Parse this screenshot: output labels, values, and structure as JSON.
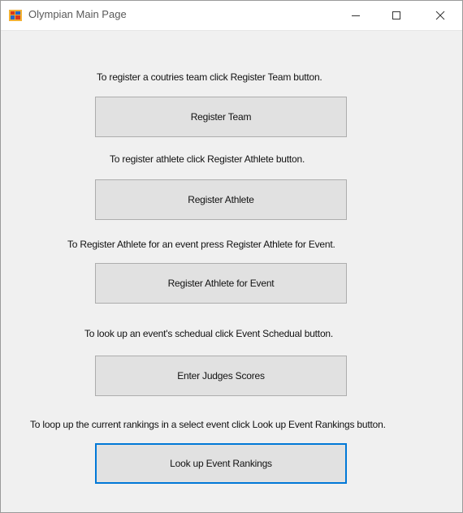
{
  "window": {
    "title": "Olympian Main Page"
  },
  "main": {
    "instructions": {
      "register_team": "To register a coutries team click Register Team button.",
      "register_athlete": "To register athlete click Register Athlete button.",
      "register_athlete_event": "To Register Athlete for an event press Register Athlete for Event.",
      "event_schedule": "To look up an event's schedual click Event Schedual button.",
      "event_rankings": "To loop up the current rankings in a select event click Look up Event Rankings button."
    },
    "buttons": {
      "register_team": "Register Team",
      "register_athlete": "Register Athlete",
      "register_athlete_event": "Register Athlete for Event",
      "enter_judges_scores": "Enter Judges Scores",
      "look_up_event_rankings": "Look up Event Rankings"
    },
    "focused_button": "look_up_event_rankings"
  },
  "colors": {
    "button_face": "#e1e1e1",
    "button_border": "#adadad",
    "focus_border": "#0078d7",
    "client_background": "#f0f0f0"
  },
  "icons": {
    "app": "application-icon",
    "minimize": "minimize-icon",
    "maximize": "maximize-icon",
    "close": "close-icon"
  }
}
